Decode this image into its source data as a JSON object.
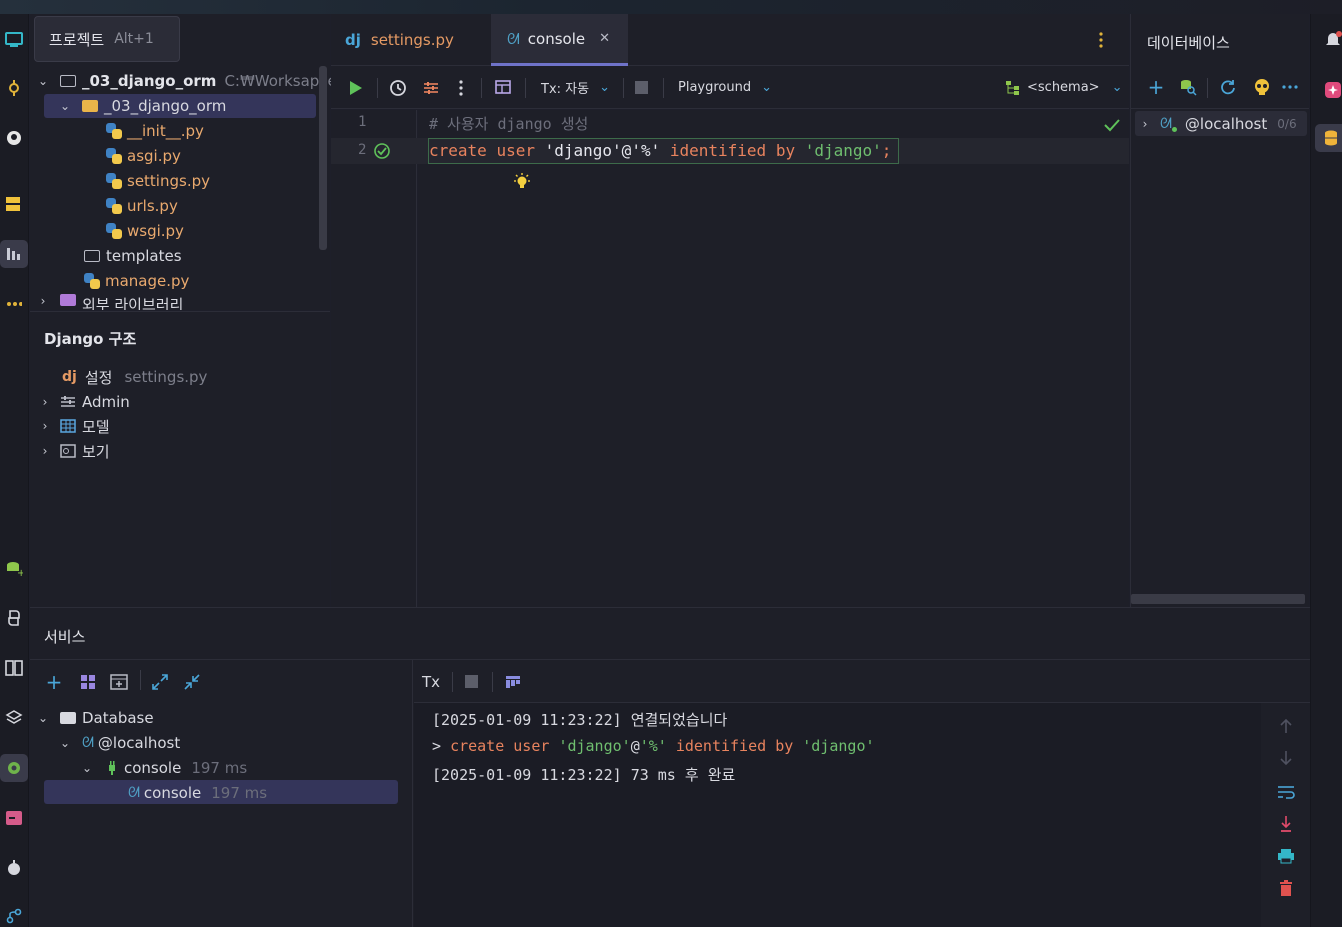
{
  "project": {
    "tab_label": "프로젝트",
    "tab_shortcut": "Alt+1",
    "root_name": "_03_django_orm",
    "root_path": "C:₩Worksapces",
    "package_name": "_03_django_orm",
    "files": [
      "__init__.py",
      "asgi.py",
      "settings.py",
      "urls.py",
      "wsgi.py"
    ],
    "templates_folder": "templates",
    "manage_file": "manage.py",
    "external_libs": "외부 라이브러리"
  },
  "django": {
    "title": "Django 구조",
    "settings_label": "설정",
    "settings_file": "settings.py",
    "items": [
      "Admin",
      "모델",
      "보기"
    ]
  },
  "editor": {
    "tabs": [
      "settings.py",
      "console"
    ],
    "toolbar": {
      "tx_label": "Tx: 자동",
      "playground_label": "Playground",
      "schema_label": "<schema>"
    },
    "lines": [
      {
        "num": "1",
        "comment": "# 사용자 django 생성"
      },
      {
        "num": "2",
        "kw1": "create",
        "kw2": "user",
        "str1": "'django'",
        "at": "@",
        "str2": "'%'",
        "kw3": "identified",
        "kw4": "by",
        "str3": "'django'",
        "semi": ";"
      }
    ]
  },
  "database": {
    "title": "데이터베이스",
    "host": "@localhost",
    "count": "0/6"
  },
  "services": {
    "title": "서비스",
    "tree": {
      "database": "Database",
      "host": "@localhost",
      "console": "console",
      "console_time": "197 ms",
      "sub_console": "console",
      "sub_time": "197 ms"
    },
    "tx_label": "Tx",
    "output": {
      "line1_ts": "[2025-01-09 11:23:22]",
      "line1_msg": "연결되었습니다",
      "line2_prompt": ">",
      "line2_kw1": "create",
      "line2_kw2": "user",
      "line2_str1": "'django'",
      "line2_at": "@",
      "line2_str2": "'%'",
      "line2_kw3": "identified",
      "line2_kw4": "by",
      "line2_str3": "'django'",
      "line3_ts": "[2025-01-09 11:23:22]",
      "line3_msg": "73 ms 후 완료"
    }
  },
  "colors": {
    "keyword": "#e8835e",
    "string": "#6fbe6f",
    "comment": "#6c6e7b",
    "accent": "#6f73c9"
  }
}
